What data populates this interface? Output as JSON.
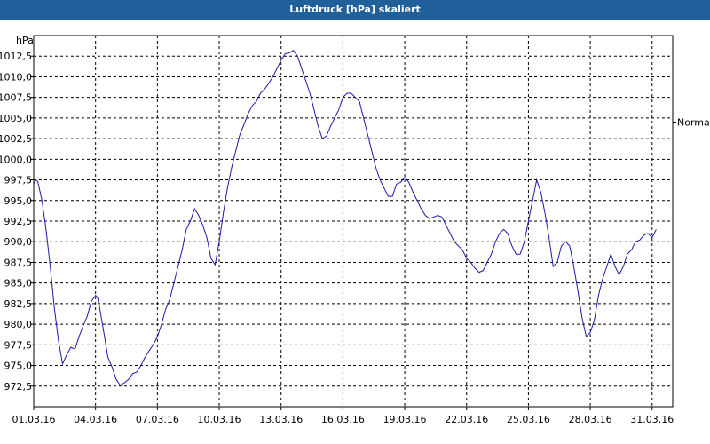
{
  "window": {
    "title": "Luftdruck [hPa] skaliert"
  },
  "chart_data": {
    "type": "line",
    "title": "Luftdruck [hPa] skaliert",
    "ylabel": "hPa",
    "xlabel": "",
    "ylim": [
      970.0,
      1015.0
    ],
    "y_ticks": [
      "972,5",
      "975,0",
      "977,5",
      "980,0",
      "982,5",
      "985,0",
      "987,5",
      "990,0",
      "992,5",
      "995,0",
      "997,5",
      "1000,0",
      "1002,5",
      "1005,0",
      "1007,5",
      "1010,0",
      "1012,5"
    ],
    "y_tick_values": [
      972.5,
      975.0,
      977.5,
      980.0,
      982.5,
      985.0,
      987.5,
      990.0,
      992.5,
      995.0,
      997.5,
      1000.0,
      1002.5,
      1005.0,
      1007.5,
      1010.0,
      1012.5
    ],
    "x_ticks": [
      "01.03.16",
      "04.03.16",
      "07.03.16",
      "10.03.16",
      "13.03.16",
      "16.03.16",
      "19.03.16",
      "22.03.16",
      "25.03.16",
      "28.03.16",
      "31.03.16"
    ],
    "x_tick_days": [
      1,
      4,
      7,
      10,
      13,
      16,
      19,
      22,
      25,
      28,
      31
    ],
    "xlim_days": [
      1,
      32
    ],
    "grid": true,
    "right_label": {
      "text": "Normal",
      "value": 1004.5
    },
    "series": [
      {
        "color": "#1a1aa8",
        "days": [
          1.0,
          1.1,
          1.2,
          1.4,
          1.6,
          1.8,
          2.0,
          2.2,
          2.4,
          2.6,
          2.8,
          3.0,
          3.2,
          3.4,
          3.6,
          3.8,
          4.0,
          4.1,
          4.2,
          4.4,
          4.6,
          4.8,
          5.0,
          5.2,
          5.4,
          5.6,
          5.8,
          6.0,
          6.2,
          6.4,
          6.6,
          6.8,
          7.0,
          7.2,
          7.4,
          7.6,
          7.8,
          8.0,
          8.2,
          8.4,
          8.6,
          8.8,
          9.0,
          9.2,
          9.4,
          9.6,
          9.8,
          10.0,
          10.2,
          10.4,
          10.6,
          10.8,
          11.0,
          11.2,
          11.4,
          11.6,
          11.8,
          12.0,
          12.2,
          12.4,
          12.6,
          12.8,
          13.0,
          13.2,
          13.4,
          13.6,
          13.8,
          14.0,
          14.2,
          14.4,
          14.6,
          14.8,
          15.0,
          15.2,
          15.4,
          15.6,
          15.8,
          16.0,
          16.2,
          16.4,
          16.6,
          16.8,
          17.0,
          17.2,
          17.4,
          17.6,
          17.8,
          18.0,
          18.2,
          18.4,
          18.6,
          18.8,
          19.0,
          19.2,
          19.4,
          19.6,
          19.8,
          20.0,
          20.2,
          20.4,
          20.6,
          20.8,
          21.0,
          21.2,
          21.4,
          21.6,
          21.8,
          22.0,
          22.2,
          22.4,
          22.6,
          22.8,
          23.0,
          23.2,
          23.4,
          23.6,
          23.8,
          24.0,
          24.2,
          24.4,
          24.6,
          24.8,
          25.0,
          25.2,
          25.4,
          25.6,
          25.8,
          26.0,
          26.2,
          26.4,
          26.6,
          26.8,
          27.0,
          27.2,
          27.4,
          27.6,
          27.8,
          28.0,
          28.2,
          28.4,
          28.6,
          28.8,
          29.0,
          29.2,
          29.4,
          29.6,
          29.8,
          30.0,
          30.2,
          30.4,
          30.6,
          30.8,
          31.0,
          31.2,
          31.4,
          31.6,
          31.8,
          32.0
        ],
        "values": [
          997.0,
          997.5,
          997.3,
          995.0,
          991.5,
          987.0,
          982.0,
          978.0,
          975.2,
          976.3,
          977.2,
          977.0,
          978.5,
          979.8,
          981.0,
          982.8,
          983.5,
          983.2,
          982.0,
          979.0,
          976.0,
          974.8,
          973.3,
          972.6,
          972.9,
          973.3,
          974.0,
          974.2,
          975.0,
          976.0,
          976.8,
          977.5,
          978.5,
          980.0,
          981.8,
          983.0,
          985.0,
          987.0,
          989.0,
          991.5,
          992.5,
          994.0,
          993.2,
          992.0,
          990.5,
          988.0,
          987.2,
          990.0,
          993.5,
          996.5,
          999.0,
          1001.0,
          1003.0,
          1004.2,
          1005.5,
          1006.5,
          1007.0,
          1008.0,
          1008.5,
          1009.2,
          1010.0,
          1011.0,
          1012.0,
          1012.8,
          1012.9,
          1013.2,
          1012.5,
          1011.0,
          1009.5,
          1008.0,
          1006.0,
          1004.0,
          1002.5,
          1002.8,
          1004.0,
          1005.0,
          1006.0,
          1007.5,
          1008.0,
          1008.0,
          1007.5,
          1007.0,
          1005.0,
          1003.0,
          1001.0,
          999.0,
          997.5,
          996.5,
          995.5,
          995.5,
          997.0,
          997.2,
          997.8,
          997.2,
          996.0,
          995.0,
          994.0,
          993.2,
          992.8,
          993.0,
          993.2,
          993.0,
          992.0,
          991.0,
          990.0,
          989.5,
          989.0,
          988.0,
          987.5,
          986.8,
          986.3,
          986.5,
          987.5,
          988.5,
          990.0,
          991.0,
          991.5,
          991.0,
          989.5,
          988.5,
          988.5,
          990.0,
          992.5,
          995.0,
          997.5,
          996.0,
          993.5,
          990.5,
          987.0,
          987.5,
          989.5,
          990.0,
          989.5,
          987.0,
          984.0,
          980.8,
          978.5,
          979.0,
          980.5,
          983.5,
          985.5,
          987.0,
          988.5,
          987.0,
          986.0,
          987.0,
          988.5,
          989.0,
          990.0,
          990.2,
          990.8,
          991.0,
          990.5,
          991.5
        ]
      }
    ]
  }
}
